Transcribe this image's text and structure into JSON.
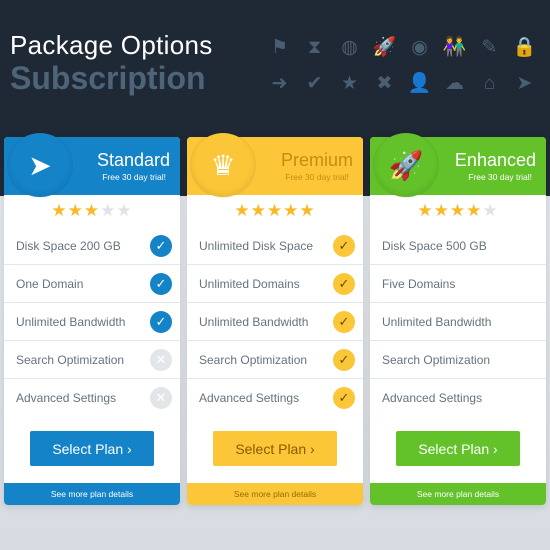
{
  "header": {
    "title_line1": "Package Options",
    "title_line2": "Subscription",
    "icons": [
      "signpost-icon",
      "hourglass-icon",
      "globe-grid-icon",
      "rocket-icon",
      "earth-icon",
      "people-icon",
      "pencil-icon",
      "lock-icon",
      "arrow-circle-icon",
      "check-circle-icon",
      "star-circle-icon",
      "x-circle-icon",
      "user-icon",
      "cloud-upload-icon",
      "home-icon",
      "paper-plane-icon"
    ]
  },
  "plans": [
    {
      "name": "Standard",
      "subtitle": "Free 30 day trial!",
      "color": "#1483c7",
      "rating": 3,
      "max_rating": 5,
      "badge_icon": "paper-plane-icon",
      "features": [
        {
          "label": "Disk Space 200 GB",
          "included": true
        },
        {
          "label": "One Domain",
          "included": true
        },
        {
          "label": "Unlimited Bandwidth",
          "included": true
        },
        {
          "label": "Search Optimization",
          "included": false
        },
        {
          "label": "Advanced Settings",
          "included": false
        }
      ],
      "button": "Select Plan ›",
      "footer": "See more plan details"
    },
    {
      "name": "Premium",
      "subtitle": "Free 30 day trial!",
      "color": "#fbc738",
      "rating": 5,
      "max_rating": 5,
      "badge_icon": "crown-icon",
      "features": [
        {
          "label": "Unlimited Disk Space",
          "included": true
        },
        {
          "label": "Unlimited Domains",
          "included": true
        },
        {
          "label": "Unlimited Bandwidth",
          "included": true
        },
        {
          "label": "Search Optimization",
          "included": true
        },
        {
          "label": "Advanced Settings",
          "included": true
        }
      ],
      "button": "Select Plan ›",
      "footer": "See more plan details"
    },
    {
      "name": "Enhanced",
      "subtitle": "Free 30 day trial!",
      "color": "#63c12a",
      "rating": 4,
      "max_rating": 5,
      "badge_icon": "rocket-icon",
      "features": [
        {
          "label": "Disk Space 500 GB"
        },
        {
          "label": "Five Domains"
        },
        {
          "label": "Unlimited Bandwidth"
        },
        {
          "label": "Search Optimization"
        },
        {
          "label": "Advanced Settings"
        }
      ],
      "button": "Select Plan ›",
      "footer": "See more plan details"
    }
  ]
}
